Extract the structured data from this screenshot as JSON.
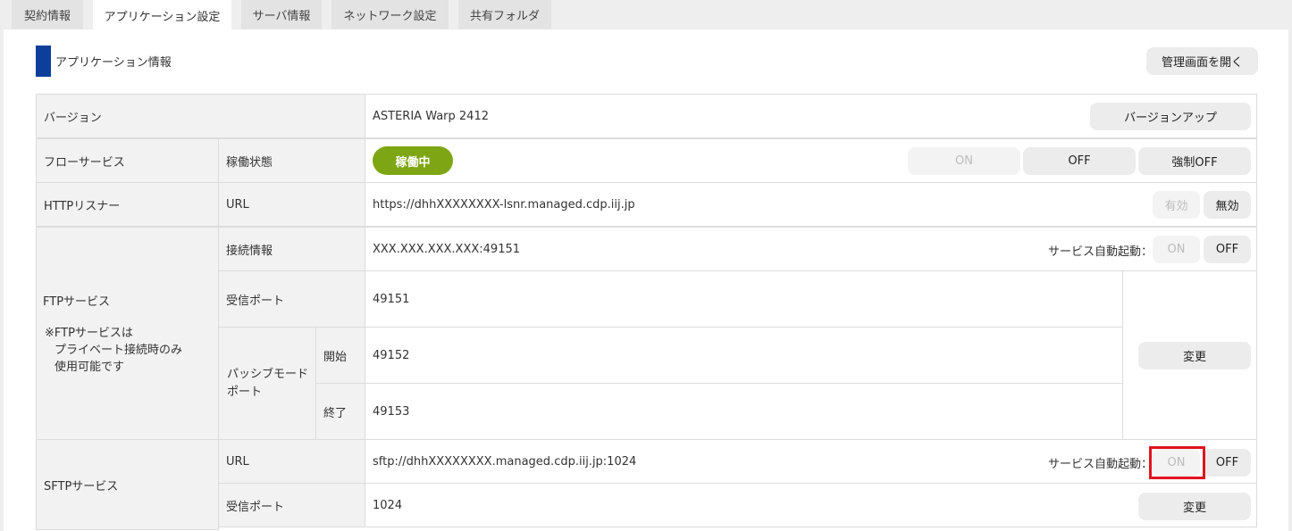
{
  "tabs": [
    {
      "label": "契約情報"
    },
    {
      "label": "アプリケーション設定"
    },
    {
      "label": "サーバ情報"
    },
    {
      "label": "ネットワーク設定"
    },
    {
      "label": "共有フォルダ"
    }
  ],
  "section": {
    "title": "アプリケーション情報",
    "open_admin_label": "管理画面を開く"
  },
  "version": {
    "label": "バージョン",
    "value": "ASTERIA Warp 2412",
    "button": "バージョンアップ"
  },
  "flow": {
    "label": "フローサービス",
    "sub_label": "稼働状態",
    "status": "稼働中",
    "on": "ON",
    "off": "OFF",
    "force_off": "強制OFF"
  },
  "http": {
    "label": "HTTPリスナー",
    "sub_label": "URL",
    "url": "https://dhhXXXXXXXX-lsnr.managed.cdp.iij.jp",
    "enable": "有効",
    "disable": "無効"
  },
  "ftp": {
    "label": "FTPサービス",
    "note_line1": "※FTPサービスは",
    "note_line2": "プライベート接続時のみ",
    "note_line3": "使用可能です",
    "conn_label": "接続情報",
    "conn_value": "XXX.XXX.XXX.XXX:49151",
    "autostart_label": "サービス自動起動：",
    "on": "ON",
    "off": "OFF",
    "port_label": "受信ポート",
    "port_value": "49151",
    "passive_line1": "パッシブモード",
    "passive_line2": "ポート",
    "start_label": "開始",
    "start_value": "49152",
    "end_label": "終了",
    "end_value": "49153",
    "change": "変更"
  },
  "sftp": {
    "label": "SFTPサービス",
    "url_label": "URL",
    "url": "sftp://dhhXXXXXXXX.managed.cdp.iij.jp:1024",
    "autostart_label": "サービス自動起動：",
    "on": "ON",
    "off": "OFF",
    "port_label": "受信ポート",
    "port_value": "1024",
    "change": "変更"
  }
}
